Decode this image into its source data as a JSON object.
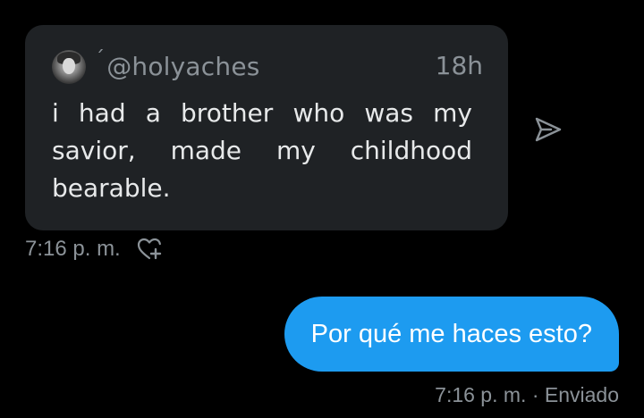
{
  "quoted_tweet": {
    "handle_mark": "ˊ",
    "handle": "@holyaches",
    "time_ago": "18h",
    "text": "i had a brother who was my savior,  made my childhood bearable."
  },
  "received": {
    "timestamp": "7:16 p. m."
  },
  "sent": {
    "text": "Por qué me haces esto?",
    "meta": "7:16 p. m. · Enviado"
  },
  "colors": {
    "background": "#000000",
    "card": "#1f2225",
    "bubble": "#1d9bf0",
    "secondary_text": "#8b9298"
  },
  "icons": {
    "share": "send-icon",
    "react": "heart-plus-icon",
    "avatar": "avatar"
  }
}
